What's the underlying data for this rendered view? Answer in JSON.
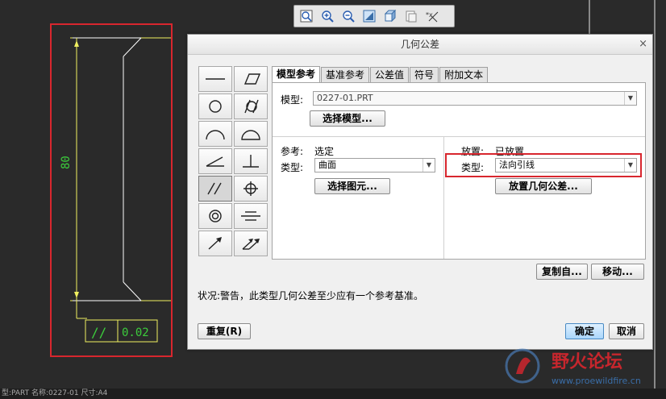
{
  "toolbar": {
    "icons": [
      "zoom-window-icon",
      "zoom-in-icon",
      "zoom-out-icon",
      "refit-icon",
      "shade-icon",
      "repaint-icon",
      "datum-display-icon"
    ]
  },
  "cad": {
    "dimension": "80",
    "fcf_symbol": "//",
    "fcf_value": "0.02",
    "line_color": "#f0f060"
  },
  "dialog": {
    "title": "几何公差",
    "close": "×",
    "tabs": [
      "模型参考",
      "基准参考",
      "公差值",
      "符号",
      "附加文本"
    ],
    "model_label": "模型:",
    "model_value": "0227-01.PRT",
    "select_model": "选择模型...",
    "ref_label": "参考:",
    "ref_value": "选定",
    "ref_type_label": "类型:",
    "ref_type_value": "曲面",
    "select_entity": "选择图元...",
    "place_label": "放置:",
    "place_value": "已放置",
    "place_type_label": "类型:",
    "place_type_value": "法向引线",
    "place_gtol": "放置几何公差...",
    "copy_from": "复制自...",
    "move": "移动...",
    "status": "状况:警告，此类型几何公差至少应有一个参考基准。",
    "reset": "重复(R)",
    "ok": "确定",
    "cancel": "取消"
  },
  "statusbar": {
    "text": "型:PART    名称:0227-01    尺寸:A4"
  },
  "watermark": {
    "title": "野火论坛",
    "url": "www.proewildfire.cn"
  }
}
